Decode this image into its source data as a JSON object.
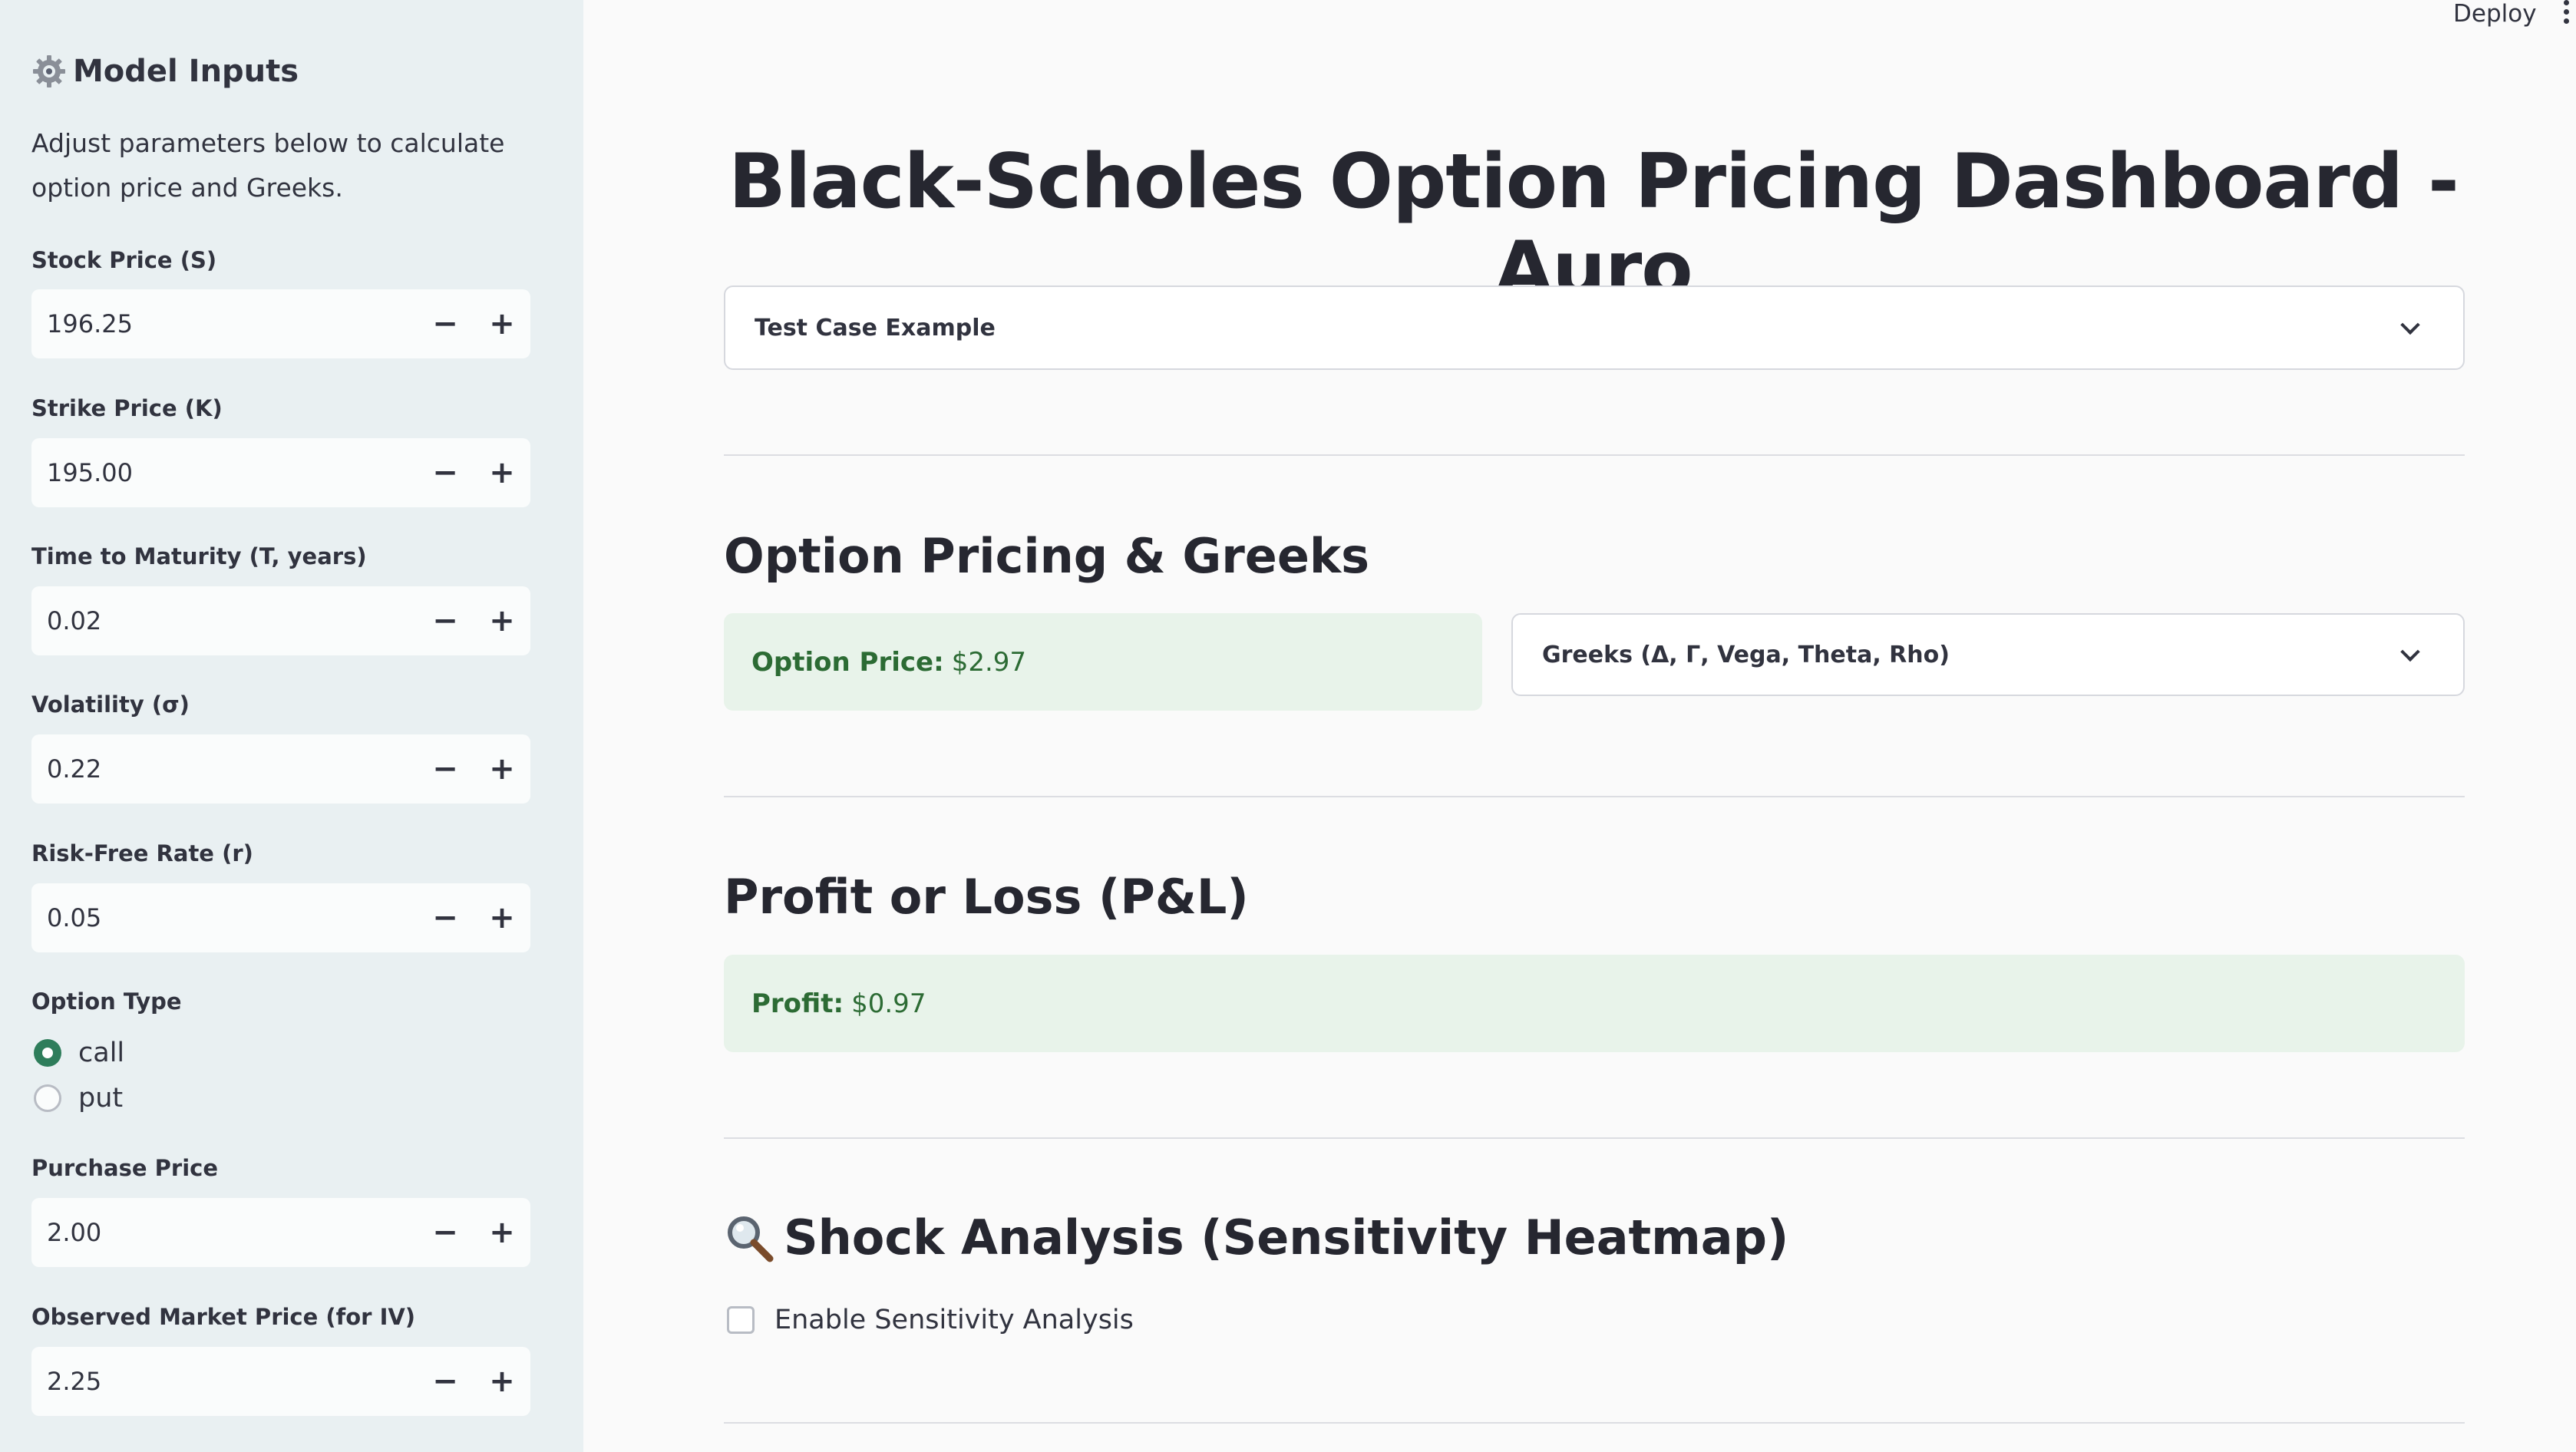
{
  "sidebar": {
    "title": "Model Inputs",
    "title_icon": "gear-icon",
    "description": "Adjust parameters below to calculate option price and Greeks.",
    "fields": [
      {
        "label": "Stock Price (S)",
        "value": "196.25"
      },
      {
        "label": "Strike Price (K)",
        "value": "195.00"
      },
      {
        "label": "Time to Maturity (T, years)",
        "value": "0.02"
      },
      {
        "label": "Volatility (σ)",
        "value": "0.22"
      },
      {
        "label": "Risk-Free Rate (r)",
        "value": "0.05"
      }
    ],
    "option_type": {
      "label": "Option Type",
      "options": [
        "call",
        "put"
      ],
      "selected": "call"
    },
    "fields2": [
      {
        "label": "Purchase Price",
        "value": "2.00"
      },
      {
        "label": "Observed Market Price (for IV)",
        "value": "2.25"
      }
    ],
    "step_minus": "−",
    "step_plus": "+"
  },
  "header": {
    "deploy_label": "Deploy"
  },
  "main": {
    "title": "Black-Scholes Option Pricing Dashboard - Auro",
    "test_case_expander": "Test Case Example",
    "pricing_section": {
      "heading": "Option Pricing & Greeks",
      "price_label": "Option Price:",
      "price_value": "$2.97",
      "greeks_expander": "Greeks (Δ, Γ, Vega, Theta, Rho)"
    },
    "pnl_section": {
      "heading": "Profit or Loss (P&L)",
      "profit_label": "Profit:",
      "profit_value": "$0.97"
    },
    "shock_section": {
      "heading": "Shock Analysis (Sensitivity Heatmap)",
      "icon": "magnifier-icon",
      "checkbox_label": "Enable Sensitivity Analysis",
      "checked": false
    }
  },
  "colors": {
    "sidebar_bg": "#e9f0f2",
    "main_bg": "#fafafa",
    "success_bg": "#e8f3ea",
    "success_text": "#2c6b34",
    "radio_selected": "#2e7d5b"
  }
}
